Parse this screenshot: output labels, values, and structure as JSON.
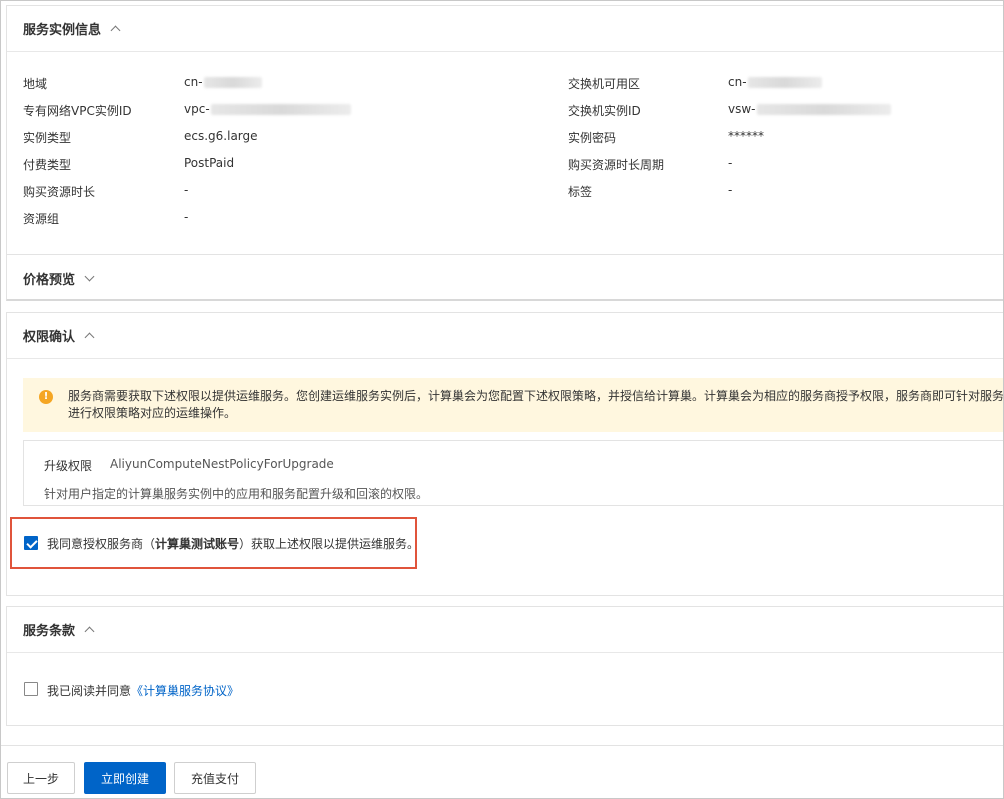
{
  "sections": {
    "instance_info": {
      "title": "服务实例信息"
    },
    "price_preview": {
      "title": "价格预览"
    },
    "permission": {
      "title": "权限确认"
    },
    "terms": {
      "title": "服务条款"
    }
  },
  "instance_info": {
    "left": [
      {
        "label": "地域",
        "value": "cn-",
        "masked": true
      },
      {
        "label": "专有网络VPC实例ID",
        "value": "vpc-",
        "masked": true
      },
      {
        "label": "实例类型",
        "value": "ecs.g6.large",
        "masked": false
      },
      {
        "label": "付费类型",
        "value": "PostPaid",
        "masked": false
      },
      {
        "label": "购买资源时长",
        "value": "-",
        "masked": false
      },
      {
        "label": "资源组",
        "value": "-",
        "masked": false
      }
    ],
    "right": [
      {
        "label": "交换机可用区",
        "value": "cn-",
        "masked": true
      },
      {
        "label": "交换机实例ID",
        "value": "vsw-",
        "masked": true
      },
      {
        "label": "实例密码",
        "value": "******",
        "masked": false
      },
      {
        "label": "购买资源时长周期",
        "value": "-",
        "masked": false
      },
      {
        "label": "标签",
        "value": "-",
        "masked": false
      }
    ]
  },
  "permission": {
    "notice_line1": "服务商需要获取下述权限以提供运维服务。您创建运维服务实例后，计算巢会为您配置下述权限策略，并授信给计算巢。计算巢会为相应的服务商授予权限，服务商即可针对服务实",
    "notice_line2": "进行权限策略对应的运维操作。",
    "item": {
      "name": "升级权限",
      "policy": "AliyunComputeNestPolicyForUpgrade",
      "description": "针对用户指定的计算巢服务实例中的应用和服务配置升级和回滚的权限。"
    },
    "agree_prefix": "我同意授权服务商（",
    "agree_provider": "计算巢测试账号",
    "agree_suffix": "）获取上述权限以提供运维服务。",
    "agree_checked": true
  },
  "terms": {
    "agree_prefix": "我已阅读并同意",
    "agreement_link": "《计算巢服务协议》",
    "agree_checked": false
  },
  "buttons": {
    "prev": "上一步",
    "create": "立即创建",
    "recharge": "充值支付"
  },
  "colors": {
    "primary": "#0064c8",
    "highlight_border": "#e0543b",
    "notice_bg": "#fff7df",
    "warning_icon": "#f5a623"
  }
}
